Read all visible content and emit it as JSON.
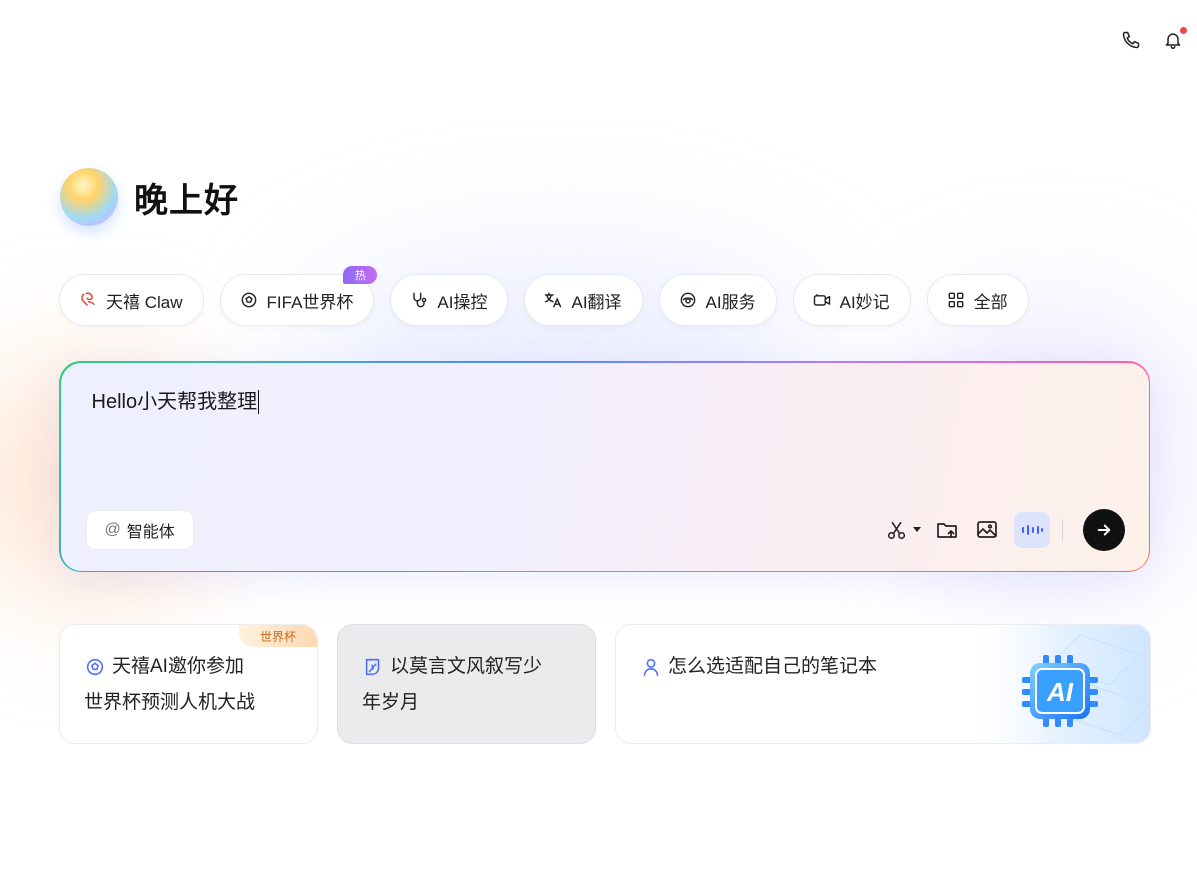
{
  "header": {
    "phone_icon": "phone-icon",
    "bell_icon": "bell-icon",
    "has_notification": true
  },
  "greeting": {
    "text": "晚上好",
    "avatar_icon": "gradient-orb"
  },
  "quick_actions": [
    {
      "label": "天禧 Claw",
      "icon": "claw-icon"
    },
    {
      "label": "FIFA世界杯",
      "icon": "soccer-icon",
      "badge": "热"
    },
    {
      "label": "AI操控",
      "icon": "control-icon"
    },
    {
      "label": "AI翻译",
      "icon": "translate-icon"
    },
    {
      "label": "AI服务",
      "icon": "service-icon"
    },
    {
      "label": "AI妙记",
      "icon": "recorder-icon"
    },
    {
      "label": "全部",
      "icon": "grid-icon"
    }
  ],
  "composer": {
    "value": "Hello小天帮我整理",
    "agent_at": "@",
    "agent_label": "智能体",
    "tools": [
      "scissors-icon",
      "folder-upload-icon",
      "image-upload-icon",
      "voice-wave-icon",
      "send-arrow-icon"
    ]
  },
  "suggestions": [
    {
      "line1": "天禧AI邀你参加",
      "line2": "世界杯预测人机大战",
      "icon": "soccer-icon",
      "tag": "世界杯"
    },
    {
      "line1": "以莫言文风叙写少",
      "line2": "年岁月",
      "icon": "leaf-icon"
    },
    {
      "line1": "怎么选适配自己的笔记本",
      "line2": "",
      "icon": "person-icon",
      "art_text": "AI"
    }
  ],
  "colors": {
    "accent_blue": "#4d6dff",
    "notification_dot": "#f2463c",
    "hot_badge": "#a46bf3",
    "send_button": "#111111"
  }
}
